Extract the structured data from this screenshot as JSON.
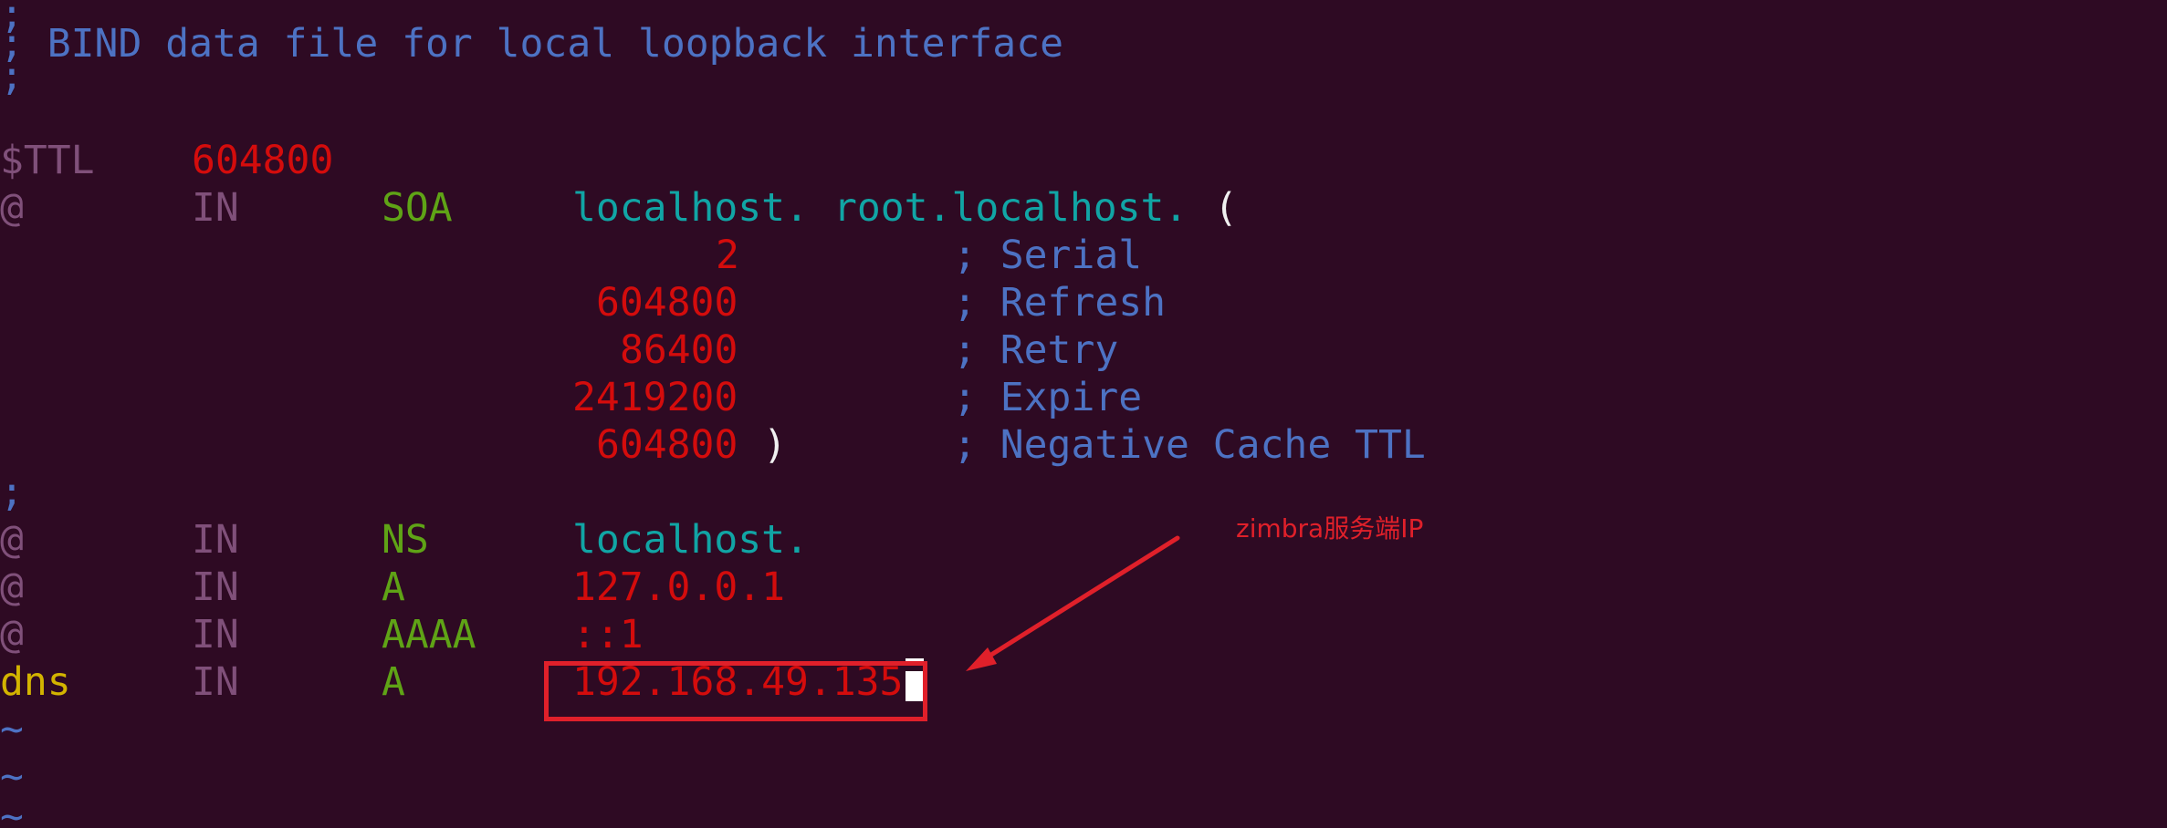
{
  "editor": {
    "lines": {
      "l0": {
        "c0": ";"
      },
      "l1": {
        "c0": "; BIND data file for local loopback interface"
      },
      "l2": {
        "c0": ";"
      },
      "l3": {
        "c0": "$TTL",
        "c1": "604800"
      },
      "l4": {
        "c0": "@",
        "c1": "IN",
        "c2": "SOA",
        "c3": "localhost.",
        "c4": "root.localhost.",
        "c5": "("
      },
      "l5": {
        "c0": "2",
        "c1": "; Serial"
      },
      "l6": {
        "c0": "604800",
        "c1": "; Refresh"
      },
      "l7": {
        "c0": "86400",
        "c1": "; Retry"
      },
      "l8": {
        "c0": "2419200",
        "c1": "; Expire"
      },
      "l9": {
        "c0": "604800",
        "c1": ")",
        "c2": "; Negative Cache TTL"
      },
      "l10": {
        "c0": ";"
      },
      "l11": {
        "c0": "@",
        "c1": "IN",
        "c2": "NS",
        "c3": "localhost."
      },
      "l12": {
        "c0": "@",
        "c1": "IN",
        "c2": "A",
        "c3": "127.0.0.1"
      },
      "l13": {
        "c0": "@",
        "c1": "IN",
        "c2": "AAAA",
        "c3": "::1"
      },
      "l14": {
        "c0": "dns",
        "c1": "IN",
        "c2": "A",
        "c3": "192.168.49.135"
      },
      "l15": {
        "c0": "~"
      },
      "l16": {
        "c0": "~"
      },
      "l17": {
        "c0": "~"
      }
    }
  },
  "annotation": {
    "label": "zimbra服务端IP",
    "color": "#e0202a"
  },
  "colors": {
    "background": "#2e0a23",
    "comment": "#4d72c3",
    "number": "#d40c0c",
    "keyword": "#5fa316",
    "hostname": "#11a5a5"
  }
}
